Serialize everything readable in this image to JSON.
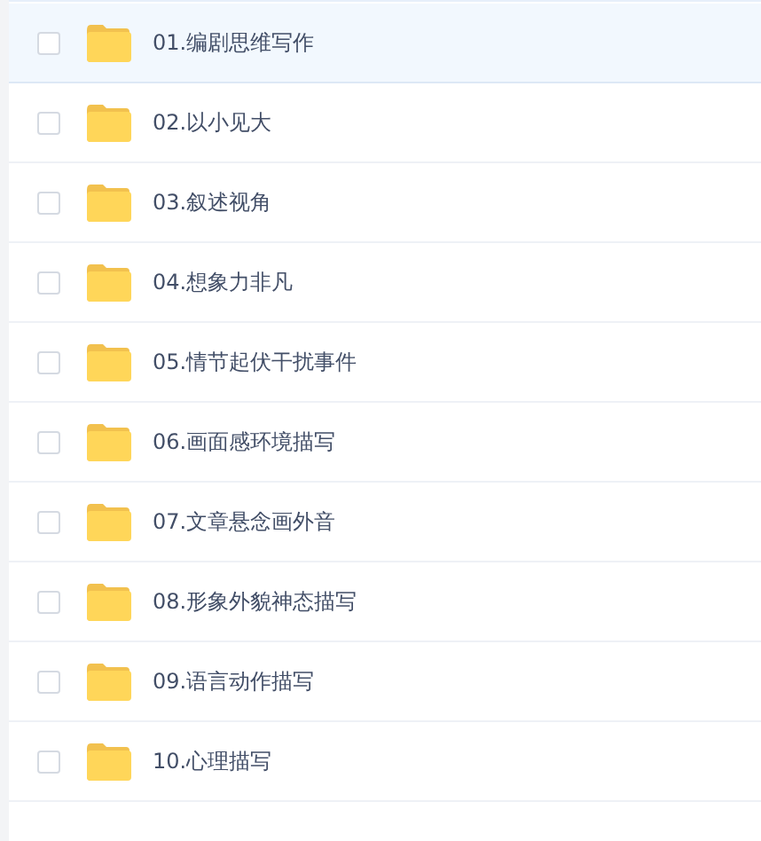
{
  "files": [
    {
      "name": "01.编剧思维写作",
      "checked": false,
      "selected": true
    },
    {
      "name": "02.以小见大",
      "checked": false,
      "selected": false
    },
    {
      "name": "03.叙述视角",
      "checked": false,
      "selected": false
    },
    {
      "name": "04.想象力非凡",
      "checked": false,
      "selected": false
    },
    {
      "name": "05.情节起伏干扰事件",
      "checked": false,
      "selected": false
    },
    {
      "name": "06.画面感环境描写",
      "checked": false,
      "selected": false
    },
    {
      "name": "07.文章悬念画外音",
      "checked": false,
      "selected": false
    },
    {
      "name": "08.形象外貌神态描写",
      "checked": false,
      "selected": false
    },
    {
      "name": "09.语言动作描写",
      "checked": false,
      "selected": false
    },
    {
      "name": "10.心理描写",
      "checked": false,
      "selected": false
    }
  ]
}
